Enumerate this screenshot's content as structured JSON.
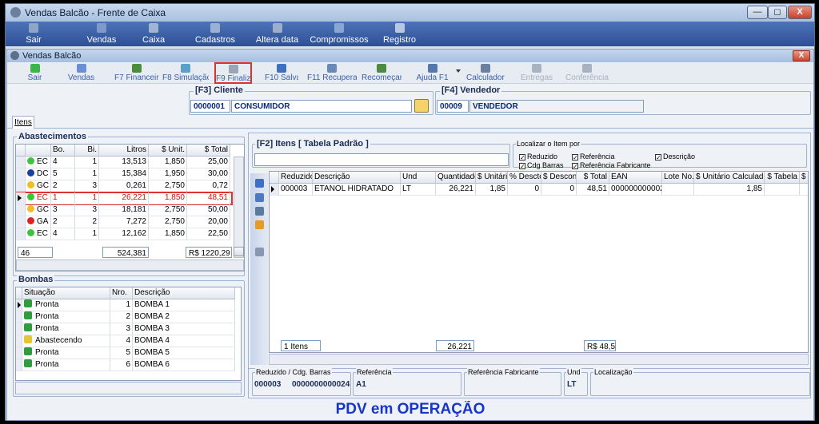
{
  "outer": {
    "title": "Vendas Balcão - Frente de Caixa",
    "min": "—",
    "max": "◻",
    "close": "X"
  },
  "menu": [
    {
      "label": "Sair",
      "name": "menu-sair",
      "color": "#8fa5c8"
    },
    {
      "label": "Vendas",
      "name": "menu-vendas",
      "color": "#7d9acb"
    },
    {
      "label": "Caixa",
      "name": "menu-caixa",
      "color": "#a0b4d5"
    },
    {
      "label": "Cadastros",
      "name": "menu-cadastros",
      "color": "#9bb1d3"
    },
    {
      "label": "Altera data",
      "name": "menu-altera-data",
      "color": "#9caec9"
    },
    {
      "label": "Compromissos",
      "name": "menu-compromissos",
      "color": "#8aa6d6"
    },
    {
      "label": "Registro",
      "name": "menu-registro",
      "color": "#b8c8e2"
    }
  ],
  "inner": {
    "title": "Vendas Balcão",
    "close": "X"
  },
  "toolbar": [
    {
      "label": "Sair",
      "name": "tb-sair",
      "color": "#3bb54a"
    },
    {
      "label": "Vendas",
      "name": "tb-vendas",
      "color": "#6c8fd1"
    },
    {
      "label": "F7 Financeiro",
      "name": "tb-f7-financeiro",
      "color": "#4b8c3c"
    },
    {
      "label": "F8 Simulação",
      "name": "tb-f8-simulacao",
      "color": "#5aa0c8"
    },
    {
      "label": "F9 Finaliza",
      "name": "tb-f9-finaliza",
      "color": "#9aa6b8"
    },
    {
      "label": "F10 Salva",
      "name": "tb-f10-salva",
      "color": "#3f6fc0"
    },
    {
      "label": "F11 Recuperar",
      "name": "tb-f11-recuperar",
      "color": "#6a8ab5"
    },
    {
      "label": "Recomeçar",
      "name": "tb-recomecar",
      "color": "#4f8a44"
    },
    {
      "label": "Ajuda F1",
      "name": "tb-ajuda-f1",
      "color": "#5577aa"
    },
    {
      "label": "Calculadora",
      "name": "tb-calculadora",
      "color": "#6c7f9c"
    },
    {
      "label": "Entregas",
      "name": "tb-entregas",
      "color": "#a9b2c0"
    },
    {
      "label": "Conferência",
      "name": "tb-conferencia",
      "color": "#a9b2c0"
    }
  ],
  "cliente": {
    "title": "[F3] Cliente",
    "code": "0000001",
    "name": "CONSUMIDOR"
  },
  "vendedor": {
    "title": "[F4] Vendedor",
    "code": "00009",
    "name": "VENDEDOR"
  },
  "tab": "Itens",
  "abast": {
    "title": "Abastecimentos",
    "cols": [
      "Bo.",
      "Bi.",
      "Litros",
      "$ Unit.",
      "$ Total"
    ],
    "rows": [
      {
        "f": "EC",
        "c": "#3cc43c",
        "bo": "4",
        "bi": "1",
        "l": "13,513",
        "u": "1,850",
        "t": "25,00"
      },
      {
        "f": "DC",
        "c": "#1a3fa0",
        "bo": "5",
        "bi": "1",
        "l": "15,384",
        "u": "1,950",
        "t": "30,00"
      },
      {
        "f": "GC",
        "c": "#f0c020",
        "bo": "2",
        "bi": "3",
        "l": "0,261",
        "u": "2,750",
        "t": "0,72"
      },
      {
        "f": "EC",
        "c": "#3cc43c",
        "bo": "1",
        "bi": "1",
        "l": "26,221",
        "u": "1,850",
        "t": "48,51"
      },
      {
        "f": "GC",
        "c": "#f0c020",
        "bo": "3",
        "bi": "3",
        "l": "18,181",
        "u": "2,750",
        "t": "50,00"
      },
      {
        "f": "GA",
        "c": "#e02020",
        "bo": "2",
        "bi": "2",
        "l": "7,272",
        "u": "2,750",
        "t": "20,00"
      },
      {
        "f": "EC",
        "c": "#3cc43c",
        "bo": "4",
        "bi": "1",
        "l": "12,162",
        "u": "1,850",
        "t": "22,50"
      }
    ],
    "footer": {
      "count": "46",
      "litros": "524,381",
      "total": "R$ 1220,29"
    }
  },
  "bombas": {
    "title": "Bombas",
    "cols": [
      "Situação",
      "Nro.",
      "Descrição"
    ],
    "rows": [
      {
        "s": "Pronta",
        "n": "1",
        "d": "BOMBA 1"
      },
      {
        "s": "Pronta",
        "n": "2",
        "d": "BOMBA 2"
      },
      {
        "s": "Pronta",
        "n": "3",
        "d": "BOMBA 3"
      },
      {
        "s": "Abastecendo",
        "n": "4",
        "d": "BOMBA 4"
      },
      {
        "s": "Pronta",
        "n": "5",
        "d": "BOMBA 5"
      },
      {
        "s": "Pronta",
        "n": "6",
        "d": "BOMBA 6"
      }
    ]
  },
  "itens": {
    "title": "[F2] Itens [ Tabela Padrão ]",
    "localizar": {
      "title": "Localizar o Item por",
      "opts": [
        "Reduzido",
        "Referência",
        "Descrição",
        "Cdg Barras",
        "Referência Fabricante"
      ]
    },
    "cols": [
      "Reduzido",
      "Descrição",
      "Und",
      "Quantidade",
      "$ Unitário",
      "% Descto",
      "$ Desconto",
      "$ Total",
      "EAN",
      "Lote No.",
      "$ Unitário Calculado",
      "$ Tabela",
      "$ To"
    ],
    "row": [
      "000003",
      "ETANOL HIDRATADO",
      "LT",
      "26,221",
      "1,85",
      "0",
      "0",
      "48,51",
      "0000000000024",
      "",
      "1,85",
      "",
      ""
    ],
    "footer": {
      "count": "1 Itens",
      "qty": "26,221",
      "total": "R$ 48,5"
    }
  },
  "bottom": {
    "red_label": "Reduzido / Cdg. Barras",
    "red_code": "000003",
    "red_bar": "0000000000024",
    "ref_label": "Referência",
    "ref_val": "A1",
    "fab_label": "Referência Fabricante",
    "und_label": "Und",
    "und_val": "LT",
    "loc_label": "Localização"
  },
  "status": "PDV em OPERAÇÃO"
}
